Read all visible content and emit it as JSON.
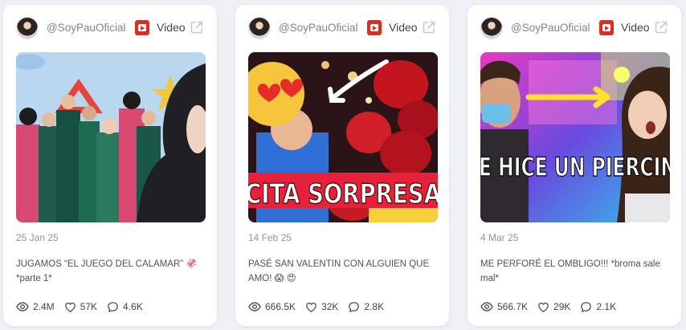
{
  "cards": [
    {
      "handle": "@SoyPauOficial",
      "type_label": "Video",
      "date": "25 Jan 25",
      "caption": "JUGAMOS “EL JUEGO DEL CALAMAR” 🦑 *parte 1*",
      "views": "2.4M",
      "likes": "57K",
      "comments": "4.6K"
    },
    {
      "handle": "@SoyPauOficial",
      "type_label": "Video",
      "date": "14 Feb 25",
      "caption": "PASÉ SAN VALENTIN CON ALGUIEN QUE AMO! 😱 😍",
      "views": "666.5K",
      "likes": "32K",
      "comments": "2.8K",
      "thumb_text": "CITA SORPRESA"
    },
    {
      "handle": "@SoyPauOficial",
      "type_label": "Video",
      "date": "4 Mar 25",
      "caption": "ME PERFORÉ EL OMBLIGO!!! *broma sale mal*",
      "views": "566.7K",
      "likes": "29K",
      "comments": "2.1K",
      "thumb_text": "E HICE UN PIERCIN"
    }
  ],
  "icons": {
    "platform": "youtube-icon",
    "open": "external-link-icon",
    "views": "eye-icon",
    "likes": "heart-icon",
    "comments": "comment-icon"
  },
  "colors": {
    "youtube_red": "#e4291f",
    "card_bg": "#ffffff",
    "page_bg": "#eef0f5"
  }
}
